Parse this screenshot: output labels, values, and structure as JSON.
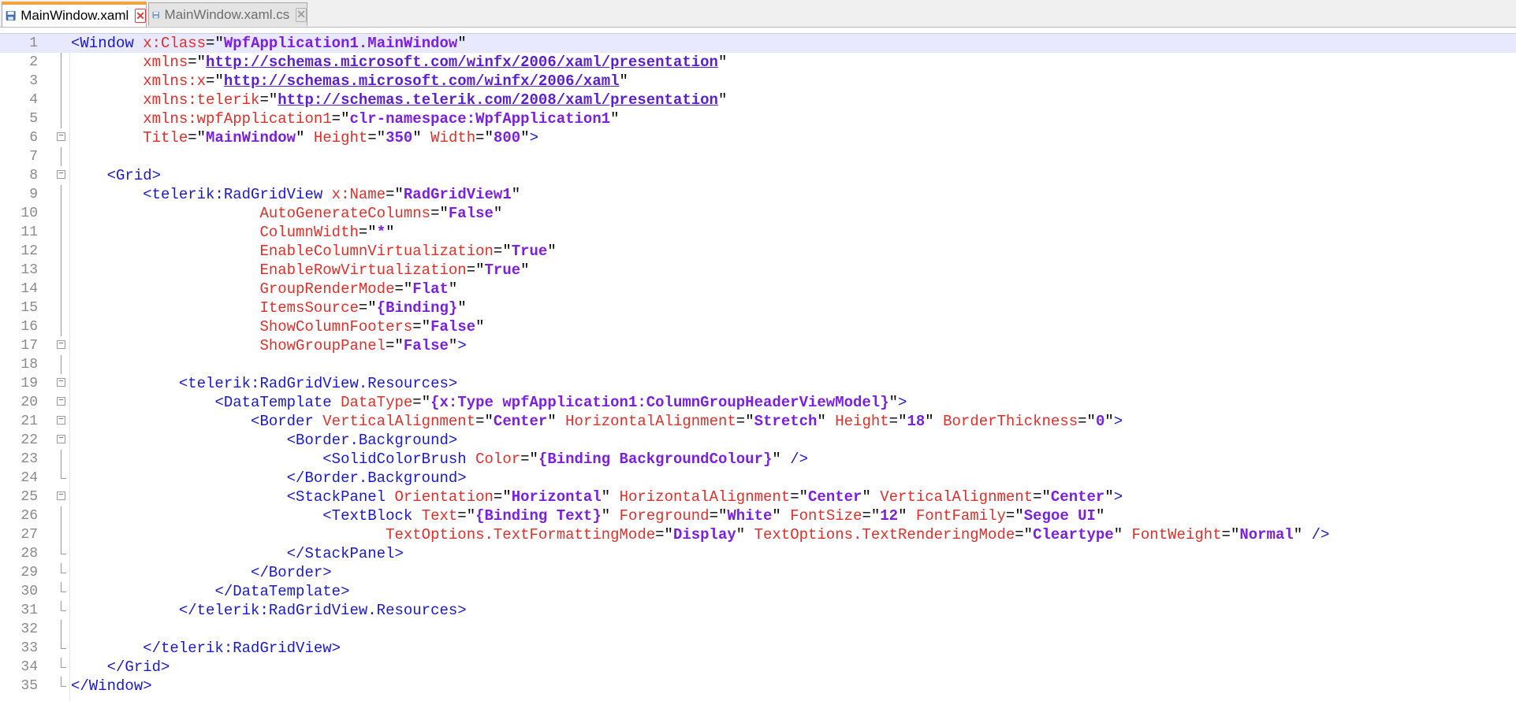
{
  "tabs": [
    {
      "label": "MainWindow.xaml",
      "active": true
    },
    {
      "label": "MainWindow.xaml.cs",
      "active": false
    }
  ],
  "editor": {
    "lines": [
      {
        "n": "1",
        "fold": "none",
        "current": true,
        "parts": [
          [
            "tag",
            "<Window "
          ],
          [
            "attr",
            "x:Class"
          ],
          [
            "eq",
            "="
          ],
          [
            "q",
            "\""
          ],
          [
            "val",
            "WpfApplication1.MainWindow"
          ],
          [
            "q",
            "\""
          ]
        ]
      },
      {
        "n": "2",
        "fold": "line",
        "parts": [
          [
            "plain",
            "        "
          ],
          [
            "attr",
            "xmlns"
          ],
          [
            "eq",
            "="
          ],
          [
            "q",
            "\""
          ],
          [
            "url",
            "http://schemas.microsoft.com/winfx/2006/xaml/presentation"
          ],
          [
            "q",
            "\""
          ]
        ]
      },
      {
        "n": "3",
        "fold": "line",
        "parts": [
          [
            "plain",
            "        "
          ],
          [
            "attr",
            "xmlns:x"
          ],
          [
            "eq",
            "="
          ],
          [
            "q",
            "\""
          ],
          [
            "url",
            "http://schemas.microsoft.com/winfx/2006/xaml"
          ],
          [
            "q",
            "\""
          ]
        ]
      },
      {
        "n": "4",
        "fold": "line",
        "parts": [
          [
            "plain",
            "        "
          ],
          [
            "attr",
            "xmlns:telerik"
          ],
          [
            "eq",
            "="
          ],
          [
            "q",
            "\""
          ],
          [
            "url",
            "http://schemas.telerik.com/2008/xaml/presentation"
          ],
          [
            "q",
            "\""
          ]
        ]
      },
      {
        "n": "5",
        "fold": "line",
        "parts": [
          [
            "plain",
            "        "
          ],
          [
            "attr",
            "xmlns:wpfApplication1"
          ],
          [
            "eq",
            "="
          ],
          [
            "q",
            "\""
          ],
          [
            "val",
            "clr-namespace:WpfApplication1"
          ],
          [
            "q",
            "\""
          ]
        ]
      },
      {
        "n": "6",
        "fold": "open",
        "parts": [
          [
            "plain",
            "        "
          ],
          [
            "attr",
            "Title"
          ],
          [
            "eq",
            "="
          ],
          [
            "q",
            "\""
          ],
          [
            "val",
            "MainWindow"
          ],
          [
            "q",
            "\" "
          ],
          [
            "attr",
            "Height"
          ],
          [
            "eq",
            "="
          ],
          [
            "q",
            "\""
          ],
          [
            "val",
            "350"
          ],
          [
            "q",
            "\" "
          ],
          [
            "attr",
            "Width"
          ],
          [
            "eq",
            "="
          ],
          [
            "q",
            "\""
          ],
          [
            "val",
            "800"
          ],
          [
            "q",
            "\""
          ],
          [
            "tag",
            ">"
          ]
        ]
      },
      {
        "n": "7",
        "fold": "line",
        "parts": []
      },
      {
        "n": "8",
        "fold": "open",
        "parts": [
          [
            "plain",
            "    "
          ],
          [
            "tag",
            "<Grid>"
          ]
        ]
      },
      {
        "n": "9",
        "fold": "line",
        "parts": [
          [
            "plain",
            "        "
          ],
          [
            "tag",
            "<telerik:RadGridView "
          ],
          [
            "attr",
            "x:Name"
          ],
          [
            "eq",
            "="
          ],
          [
            "q",
            "\""
          ],
          [
            "val",
            "RadGridView1"
          ],
          [
            "q",
            "\""
          ]
        ]
      },
      {
        "n": "10",
        "fold": "line",
        "parts": [
          [
            "plain",
            "                     "
          ],
          [
            "attr",
            "AutoGenerateColumns"
          ],
          [
            "eq",
            "="
          ],
          [
            "q",
            "\""
          ],
          [
            "val",
            "False"
          ],
          [
            "q",
            "\""
          ]
        ]
      },
      {
        "n": "11",
        "fold": "line",
        "parts": [
          [
            "plain",
            "                     "
          ],
          [
            "attr",
            "ColumnWidth"
          ],
          [
            "eq",
            "="
          ],
          [
            "q",
            "\""
          ],
          [
            "val",
            "*"
          ],
          [
            "q",
            "\""
          ]
        ]
      },
      {
        "n": "12",
        "fold": "line",
        "parts": [
          [
            "plain",
            "                     "
          ],
          [
            "attr",
            "EnableColumnVirtualization"
          ],
          [
            "eq",
            "="
          ],
          [
            "q",
            "\""
          ],
          [
            "val",
            "True"
          ],
          [
            "q",
            "\""
          ]
        ]
      },
      {
        "n": "13",
        "fold": "line",
        "parts": [
          [
            "plain",
            "                     "
          ],
          [
            "attr",
            "EnableRowVirtualization"
          ],
          [
            "eq",
            "="
          ],
          [
            "q",
            "\""
          ],
          [
            "val",
            "True"
          ],
          [
            "q",
            "\""
          ]
        ]
      },
      {
        "n": "14",
        "fold": "line",
        "parts": [
          [
            "plain",
            "                     "
          ],
          [
            "attr",
            "GroupRenderMode"
          ],
          [
            "eq",
            "="
          ],
          [
            "q",
            "\""
          ],
          [
            "val",
            "Flat"
          ],
          [
            "q",
            "\""
          ]
        ]
      },
      {
        "n": "15",
        "fold": "line",
        "parts": [
          [
            "plain",
            "                     "
          ],
          [
            "attr",
            "ItemsSource"
          ],
          [
            "eq",
            "="
          ],
          [
            "q",
            "\""
          ],
          [
            "val",
            "{Binding}"
          ],
          [
            "q",
            "\""
          ]
        ]
      },
      {
        "n": "16",
        "fold": "line",
        "parts": [
          [
            "plain",
            "                     "
          ],
          [
            "attr",
            "ShowColumnFooters"
          ],
          [
            "eq",
            "="
          ],
          [
            "q",
            "\""
          ],
          [
            "val",
            "False"
          ],
          [
            "q",
            "\""
          ]
        ]
      },
      {
        "n": "17",
        "fold": "open",
        "parts": [
          [
            "plain",
            "                     "
          ],
          [
            "attr",
            "ShowGroupPanel"
          ],
          [
            "eq",
            "="
          ],
          [
            "q",
            "\""
          ],
          [
            "val",
            "False"
          ],
          [
            "q",
            "\""
          ],
          [
            "tag",
            ">"
          ]
        ]
      },
      {
        "n": "18",
        "fold": "line",
        "parts": []
      },
      {
        "n": "19",
        "fold": "open",
        "parts": [
          [
            "plain",
            "            "
          ],
          [
            "tag",
            "<telerik:RadGridView.Resources>"
          ]
        ]
      },
      {
        "n": "20",
        "fold": "open",
        "parts": [
          [
            "plain",
            "                "
          ],
          [
            "tag",
            "<DataTemplate "
          ],
          [
            "attr",
            "DataType"
          ],
          [
            "eq",
            "="
          ],
          [
            "q",
            "\""
          ],
          [
            "val",
            "{x:Type wpfApplication1:ColumnGroupHeaderViewModel}"
          ],
          [
            "q",
            "\""
          ],
          [
            "tag",
            ">"
          ]
        ]
      },
      {
        "n": "21",
        "fold": "open",
        "parts": [
          [
            "plain",
            "                    "
          ],
          [
            "tag",
            "<Border "
          ],
          [
            "attr",
            "VerticalAlignment"
          ],
          [
            "eq",
            "="
          ],
          [
            "q",
            "\""
          ],
          [
            "val",
            "Center"
          ],
          [
            "q",
            "\" "
          ],
          [
            "attr",
            "HorizontalAlignment"
          ],
          [
            "eq",
            "="
          ],
          [
            "q",
            "\""
          ],
          [
            "val",
            "Stretch"
          ],
          [
            "q",
            "\" "
          ],
          [
            "attr",
            "Height"
          ],
          [
            "eq",
            "="
          ],
          [
            "q",
            "\""
          ],
          [
            "val",
            "18"
          ],
          [
            "q",
            "\" "
          ],
          [
            "attr",
            "BorderThickness"
          ],
          [
            "eq",
            "="
          ],
          [
            "q",
            "\""
          ],
          [
            "val",
            "0"
          ],
          [
            "q",
            "\""
          ],
          [
            "tag",
            ">"
          ]
        ]
      },
      {
        "n": "22",
        "fold": "open",
        "parts": [
          [
            "plain",
            "                        "
          ],
          [
            "tag",
            "<Border.Background>"
          ]
        ]
      },
      {
        "n": "23",
        "fold": "line",
        "parts": [
          [
            "plain",
            "                            "
          ],
          [
            "tag",
            "<SolidColorBrush "
          ],
          [
            "attr",
            "Color"
          ],
          [
            "eq",
            "="
          ],
          [
            "q",
            "\""
          ],
          [
            "val",
            "{Binding BackgroundColour}"
          ],
          [
            "q",
            "\" "
          ],
          [
            "tag",
            "/>"
          ]
        ]
      },
      {
        "n": "24",
        "fold": "end",
        "parts": [
          [
            "plain",
            "                        "
          ],
          [
            "tag",
            "</Border.Background>"
          ]
        ]
      },
      {
        "n": "25",
        "fold": "open",
        "parts": [
          [
            "plain",
            "                        "
          ],
          [
            "tag",
            "<StackPanel "
          ],
          [
            "attr",
            "Orientation"
          ],
          [
            "eq",
            "="
          ],
          [
            "q",
            "\""
          ],
          [
            "val",
            "Horizontal"
          ],
          [
            "q",
            "\" "
          ],
          [
            "attr",
            "HorizontalAlignment"
          ],
          [
            "eq",
            "="
          ],
          [
            "q",
            "\""
          ],
          [
            "val",
            "Center"
          ],
          [
            "q",
            "\" "
          ],
          [
            "attr",
            "VerticalAlignment"
          ],
          [
            "eq",
            "="
          ],
          [
            "q",
            "\""
          ],
          [
            "val",
            "Center"
          ],
          [
            "q",
            "\""
          ],
          [
            "tag",
            ">"
          ]
        ]
      },
      {
        "n": "26",
        "fold": "line",
        "parts": [
          [
            "plain",
            "                            "
          ],
          [
            "tag",
            "<TextBlock "
          ],
          [
            "attr",
            "Text"
          ],
          [
            "eq",
            "="
          ],
          [
            "q",
            "\""
          ],
          [
            "val",
            "{Binding Text}"
          ],
          [
            "q",
            "\" "
          ],
          [
            "attr",
            "Foreground"
          ],
          [
            "eq",
            "="
          ],
          [
            "q",
            "\""
          ],
          [
            "val",
            "White"
          ],
          [
            "q",
            "\" "
          ],
          [
            "attr",
            "FontSize"
          ],
          [
            "eq",
            "="
          ],
          [
            "q",
            "\""
          ],
          [
            "val",
            "12"
          ],
          [
            "q",
            "\" "
          ],
          [
            "attr",
            "FontFamily"
          ],
          [
            "eq",
            "="
          ],
          [
            "q",
            "\""
          ],
          [
            "val",
            "Segoe UI"
          ],
          [
            "q",
            "\""
          ]
        ]
      },
      {
        "n": "27",
        "fold": "line",
        "parts": [
          [
            "plain",
            "                                   "
          ],
          [
            "attr",
            "TextOptions.TextFormattingMode"
          ],
          [
            "eq",
            "="
          ],
          [
            "q",
            "\""
          ],
          [
            "val",
            "Display"
          ],
          [
            "q",
            "\" "
          ],
          [
            "attr",
            "TextOptions.TextRenderingMode"
          ],
          [
            "eq",
            "="
          ],
          [
            "q",
            "\""
          ],
          [
            "val",
            "Cleartype"
          ],
          [
            "q",
            "\" "
          ],
          [
            "attr",
            "FontWeight"
          ],
          [
            "eq",
            "="
          ],
          [
            "q",
            "\""
          ],
          [
            "val",
            "Normal"
          ],
          [
            "q",
            "\" "
          ],
          [
            "tag",
            "/>"
          ]
        ]
      },
      {
        "n": "28",
        "fold": "end",
        "parts": [
          [
            "plain",
            "                        "
          ],
          [
            "tag",
            "</StackPanel>"
          ]
        ]
      },
      {
        "n": "29",
        "fold": "end",
        "parts": [
          [
            "plain",
            "                    "
          ],
          [
            "tag",
            "</Border>"
          ]
        ]
      },
      {
        "n": "30",
        "fold": "end",
        "parts": [
          [
            "plain",
            "                "
          ],
          [
            "tag",
            "</DataTemplate>"
          ]
        ]
      },
      {
        "n": "31",
        "fold": "end",
        "parts": [
          [
            "plain",
            "            "
          ],
          [
            "tag",
            "</telerik:RadGridView.Resources>"
          ]
        ]
      },
      {
        "n": "32",
        "fold": "line",
        "parts": []
      },
      {
        "n": "33",
        "fold": "end",
        "parts": [
          [
            "plain",
            "        "
          ],
          [
            "tag",
            "</telerik:RadGridView>"
          ]
        ]
      },
      {
        "n": "34",
        "fold": "end",
        "parts": [
          [
            "plain",
            "    "
          ],
          [
            "tag",
            "</Grid>"
          ]
        ]
      },
      {
        "n": "35",
        "fold": "end",
        "parts": [
          [
            "tag",
            "</Window>"
          ]
        ]
      }
    ]
  }
}
